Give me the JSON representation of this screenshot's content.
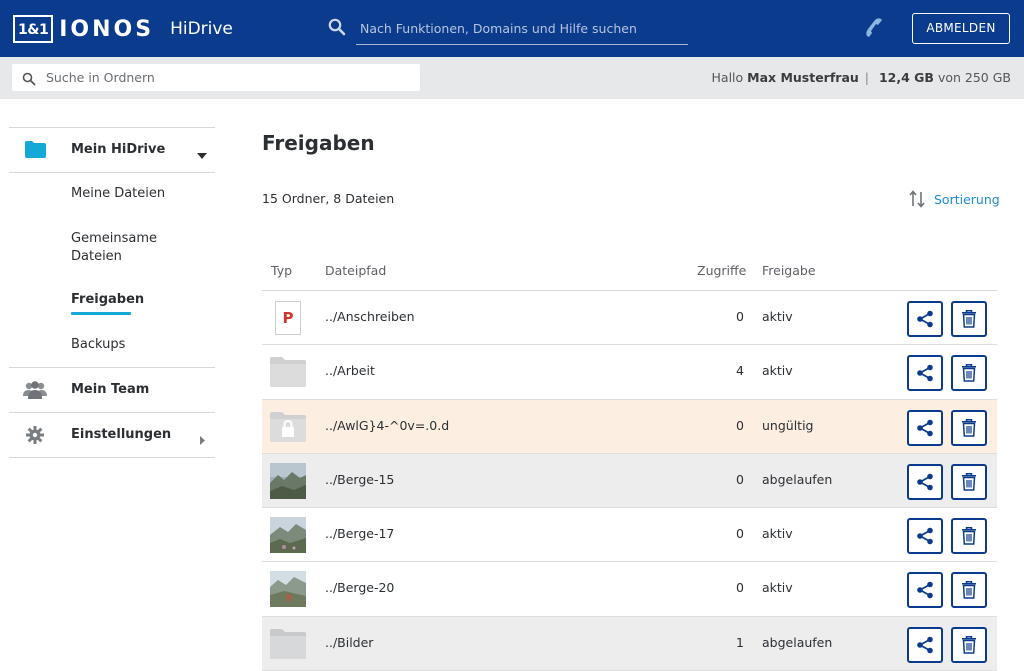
{
  "header": {
    "logo_box": "1&1",
    "logo_brand": "IONOS",
    "app_name": "HiDrive",
    "search_placeholder": "Nach Funktionen, Domains und Hilfe suchen",
    "logout_label": "ABMELDEN",
    "colors": {
      "bar": "#0b3b8c",
      "accent": "#14a8d6"
    }
  },
  "subbar": {
    "search_placeholder": "Suche in Ordnern",
    "greeting": "Hallo",
    "user_name": "Max Musterfrau",
    "storage_used": "12,4 GB",
    "storage_total": "von 250 GB"
  },
  "sidebar": {
    "mein_hidrive": "Mein HiDrive",
    "sub": {
      "meine_dateien": "Meine Dateien",
      "gemeinsame_1": "Gemeinsame",
      "gemeinsame_2": "Dateien",
      "freigaben": "Freigaben",
      "backups": "Backups"
    },
    "mein_team": "Mein Team",
    "einstellungen": "Einstellungen"
  },
  "main": {
    "title": "Freigaben",
    "count": "15 Ordner, 8 Dateien",
    "sort_label": "Sortierung",
    "columns": {
      "type": "Typ",
      "path": "Dateipfad",
      "hits": "Zugriffe",
      "share": "Freigabe"
    },
    "rows": [
      {
        "icon": "pdf-icon",
        "type_letter": "P",
        "path": "../Anschreiben",
        "hits": "0",
        "status": "aktiv"
      },
      {
        "icon": "folder-icon",
        "path": "../Arbeit",
        "hits": "4",
        "status": "aktiv"
      },
      {
        "icon": "locked-folder-icon",
        "path": "../AwlG}4-^0v=.0.d",
        "hits": "0",
        "status": "ungültig"
      },
      {
        "icon": "image-thumbnail",
        "path": "../Berge-15",
        "hits": "0",
        "status": "abgelaufen"
      },
      {
        "icon": "image-thumbnail",
        "path": "../Berge-17",
        "hits": "0",
        "status": "aktiv"
      },
      {
        "icon": "image-thumbnail",
        "path": "../Berge-20",
        "hits": "0",
        "status": "aktiv"
      },
      {
        "icon": "folder-icon",
        "path": "../Bilder",
        "hits": "1",
        "status": "abgelaufen"
      }
    ]
  }
}
